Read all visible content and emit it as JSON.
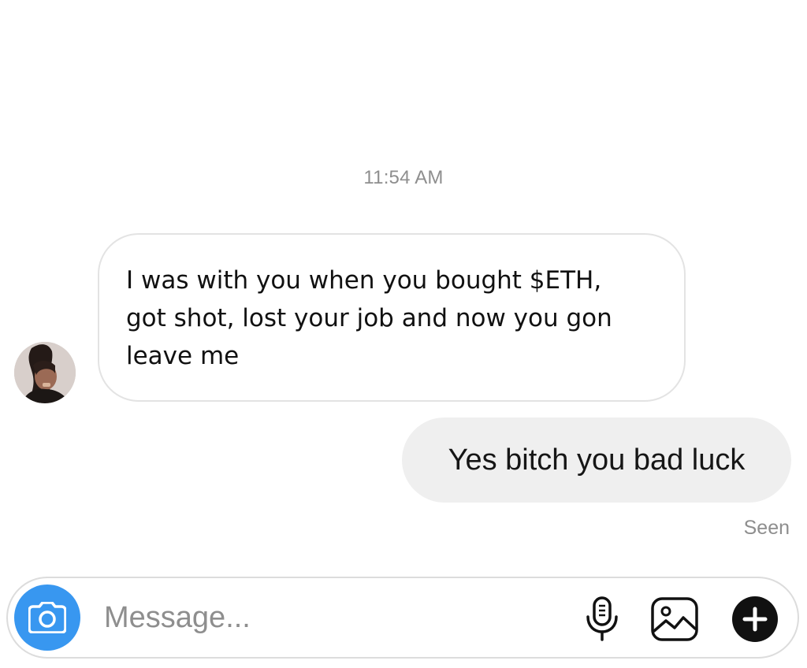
{
  "conversation": {
    "timestamp": "11:54 AM",
    "messages": [
      {
        "direction": "incoming",
        "lines": [
          "I was with you when you bought $ETH,",
          "got shot, lost your job and now you gon",
          "leave me"
        ]
      },
      {
        "direction": "outgoing",
        "text": "Yes bitch you bad luck"
      }
    ],
    "read_receipt": "Seen"
  },
  "composer": {
    "placeholder": "Message...",
    "icons": {
      "camera": "camera-icon",
      "mic": "microphone-icon",
      "gallery": "image-icon",
      "more": "plus-icon"
    }
  },
  "colors": {
    "accent": "#3897f0",
    "outgoing_bubble": "#efefef",
    "incoming_border": "#e3e3e3",
    "secondary_text": "#8e8e8e"
  }
}
